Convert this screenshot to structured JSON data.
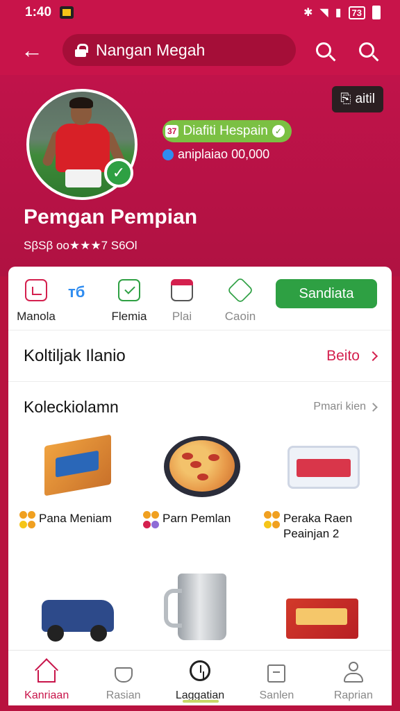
{
  "status_bar": {
    "time": "1:40",
    "battery_label": "73"
  },
  "top_bar": {
    "title": "Nangan Megah"
  },
  "profile": {
    "name": "Pemgan Pempian",
    "stats": "SβSβ oo★★★7 S6Ol",
    "edit_label": "aitil",
    "badge_number": "37",
    "badge_text": "Diafiti Hespain",
    "followers_text": "aniplaiao 00,000"
  },
  "actions": {
    "items": [
      {
        "label": "Manola"
      },
      {
        "label": "Flemia"
      },
      {
        "label": "Plai"
      },
      {
        "label": "Caoin"
      }
    ],
    "blue_glyph": "тб",
    "primary_label": "Sandiata"
  },
  "row": {
    "label": "Koltiljak Ilanio",
    "action": "Beito"
  },
  "collection": {
    "title": "Koleckiolamn",
    "more_label": "Pmari kien",
    "items": [
      {
        "label": "Pana Meniam"
      },
      {
        "label": "Parn Pemlan"
      },
      {
        "label": "Peraka Raen Peainjan 2"
      },
      {
        "label": ""
      },
      {
        "label": ""
      },
      {
        "label": ""
      }
    ]
  },
  "bottom_nav": {
    "items": [
      {
        "label": "Kanriaan"
      },
      {
        "label": "Rasian"
      },
      {
        "label": "Laggatian"
      },
      {
        "label": "Sanlen"
      },
      {
        "label": "Raprian"
      }
    ],
    "active_index": 0
  },
  "colors": {
    "brand": "#c8144a",
    "accent_green": "#2ea043",
    "badge_green": "#7bc043"
  },
  "icons": [
    "back-arrow-icon",
    "lock-icon",
    "search-icon",
    "verified-check-icon",
    "home-icon",
    "pot-icon",
    "clock-icon",
    "bag-icon",
    "user-icon"
  ]
}
